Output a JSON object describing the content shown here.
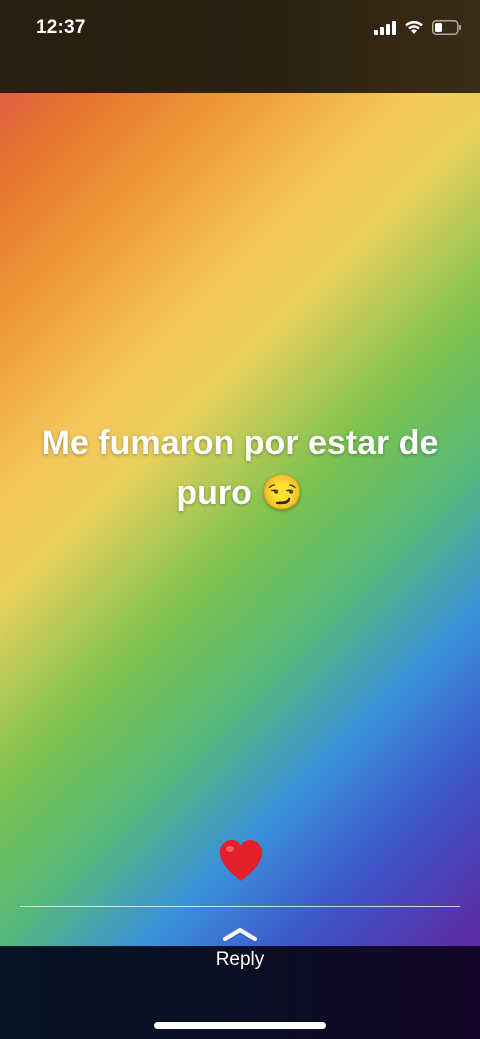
{
  "status_bar": {
    "time": "12:37",
    "icons": [
      "cellular-signal-icon",
      "wifi-icon",
      "battery-icon"
    ]
  },
  "story": {
    "text": "Me fumaron por estar de puro 😏",
    "reaction_icon": "heart-icon",
    "reaction_color": "#e0202a"
  },
  "reply": {
    "label": "Reply",
    "icon": "chevron-up-icon"
  }
}
